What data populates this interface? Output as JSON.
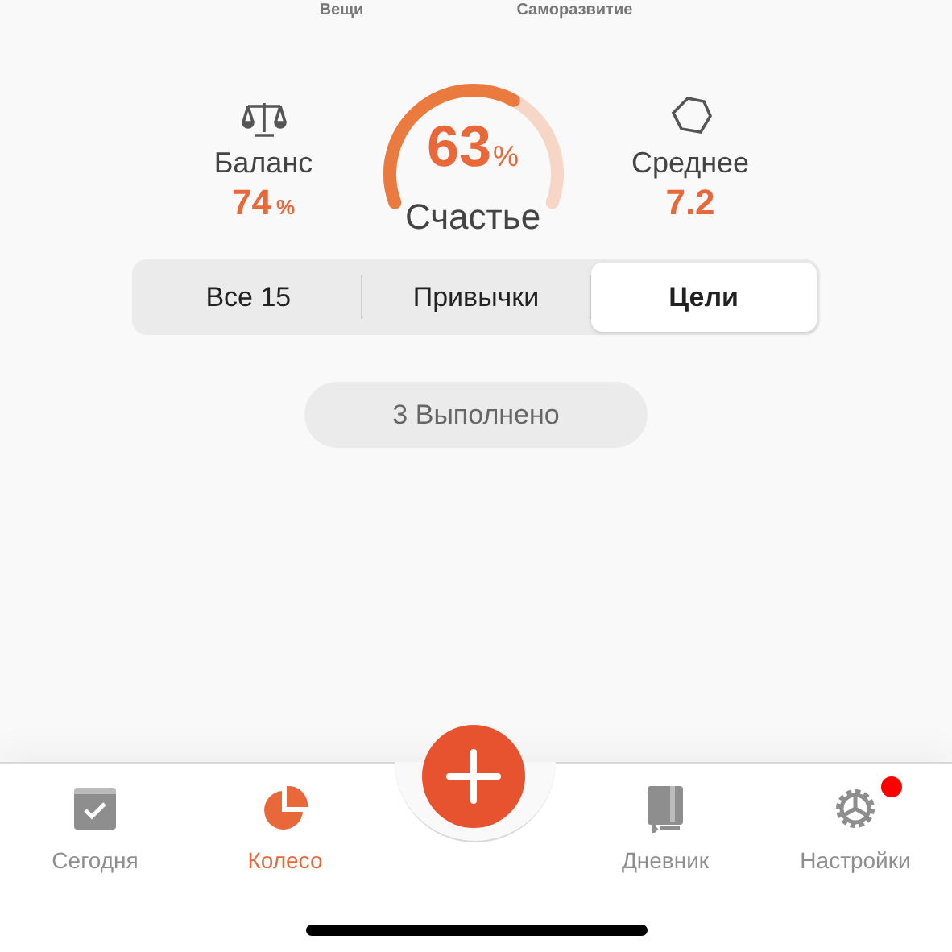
{
  "top_labels": [
    "Вещи",
    "Саморазвитие"
  ],
  "stats": {
    "balance": {
      "label": "Баланс",
      "value": "74",
      "unit": "%"
    },
    "happiness": {
      "value": "63",
      "unit": "%",
      "label": "Счастье"
    },
    "average": {
      "label": "Среднее",
      "value": "7.2"
    }
  },
  "segments": [
    {
      "label": "Все 15",
      "selected": false
    },
    {
      "label": "Привычки",
      "selected": false
    },
    {
      "label": "Цели",
      "selected": true
    }
  ],
  "done_button": "3 Выполнено",
  "tab_bar": [
    {
      "kind": "today",
      "label": "Сегодня",
      "selected": false,
      "badge": false
    },
    {
      "kind": "wheel",
      "label": "Колесо",
      "selected": true,
      "badge": false
    },
    {
      "kind": "journal",
      "label": "Дневник",
      "selected": false,
      "badge": false
    },
    {
      "kind": "settings",
      "label": "Настройки",
      "selected": false,
      "badge": true
    }
  ]
}
